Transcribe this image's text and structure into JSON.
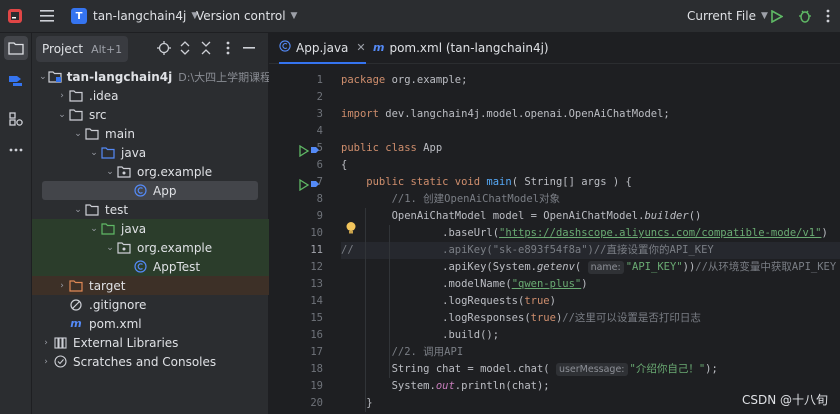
{
  "titlebar": {
    "project_initial": "T",
    "project_name": "tan-langchain4j",
    "vcs_label": "Version control",
    "run_config": "Current File"
  },
  "project_panel": {
    "title": "Project",
    "shortcut": "Alt+1",
    "tree": [
      {
        "label": "tan-langchain4j",
        "detail": "D:\\大四上学期课程\\软件",
        "icon": "module-folder-icon",
        "expanded": true
      },
      {
        "label": ".idea",
        "icon": "folder-icon",
        "expanded": false
      },
      {
        "label": "src",
        "icon": "folder-icon",
        "expanded": true
      },
      {
        "label": "main",
        "icon": "folder-icon",
        "expanded": true
      },
      {
        "label": "java",
        "icon": "source-folder-icon",
        "expanded": true
      },
      {
        "label": "org.example",
        "icon": "package-icon",
        "expanded": true
      },
      {
        "label": "App",
        "icon": "java-class-icon",
        "selected": true
      },
      {
        "label": "test",
        "icon": "folder-icon",
        "expanded": true
      },
      {
        "label": "java",
        "icon": "test-source-folder-icon",
        "expanded": true
      },
      {
        "label": "org.example",
        "icon": "package-icon",
        "expanded": true
      },
      {
        "label": "AppTest",
        "icon": "java-class-icon"
      },
      {
        "label": "target",
        "icon": "excluded-folder-icon",
        "expanded": false
      },
      {
        "label": ".gitignore",
        "icon": "gitignore-icon"
      },
      {
        "label": "pom.xml",
        "icon": "maven-icon"
      },
      {
        "label": "External Libraries",
        "icon": "libraries-icon",
        "expanded": false
      },
      {
        "label": "Scratches and Consoles",
        "icon": "scratches-icon",
        "expanded": false
      }
    ]
  },
  "editor": {
    "tabs": [
      {
        "label": "App.java",
        "active": true
      },
      {
        "label": "pom.xml (tan-langchain4j)",
        "active": false
      }
    ],
    "line_numbers": [
      "1",
      "2",
      "3",
      "4",
      "5",
      "6",
      "7",
      "8",
      "9",
      "10",
      "11",
      "12",
      "13",
      "14",
      "15",
      "16",
      "17",
      "18",
      "19",
      "20"
    ],
    "hint_name": "name:",
    "hint_user_message": "userMessage:",
    "code": {
      "l1_kw": "package",
      "l1_rest": " org.example;",
      "l3_kw": "import",
      "l3_rest": " dev.langchain4j.model.openai.OpenAiChatModel;",
      "l5_kw": "public class",
      "l5_rest": " App",
      "l6": "{",
      "l7_kw": "    public static void",
      "l7_fn": " main",
      "l7_rest": "( String[] args ) {",
      "l8": "        //1. 创建OpenAiChatModel对象",
      "l9_a": "        OpenAiChatModel model = OpenAiChatModel.",
      "l9_b": "builder",
      "l9_c": "()",
      "l10_a": "                .baseUrl(",
      "l10_b": "\"https://dashscope.aliyuncs.com/compatible-mode/v1\"",
      "l10_c": ")",
      "l11": "//              .apiKey(\"sk-e893f54f8a\")//直接设置你的API_KEY",
      "l12_a": "                .apiKey(System.",
      "l12_b": "getenv",
      "l12_c": "( ",
      "l12_d": "\"API_KEY\"",
      "l12_e": "))",
      "l12_f": "//从环境变量中获取API_KEY",
      "l13_a": "                .modelName(",
      "l13_b": "\"qwen-plus\"",
      "l13_c": ")",
      "l14_a": "                .logRequests(",
      "l14_b": "true",
      "l14_c": ")",
      "l15_a": "                .logResponses(",
      "l15_b": "true",
      "l15_c": ")",
      "l15_d": "//这里可以设置是否打印日志",
      "l16": "                .build();",
      "l17": "        //2. 调用API",
      "l18_a": "        String chat = model.chat( ",
      "l18_b": "\"介绍你自己！\"",
      "l18_c": ");",
      "l19_a": "        System.",
      "l19_b": "out",
      "l19_c": ".println(chat);",
      "l20": "    }",
      "l21": "}"
    }
  },
  "watermark": "CSDN @十八旬"
}
